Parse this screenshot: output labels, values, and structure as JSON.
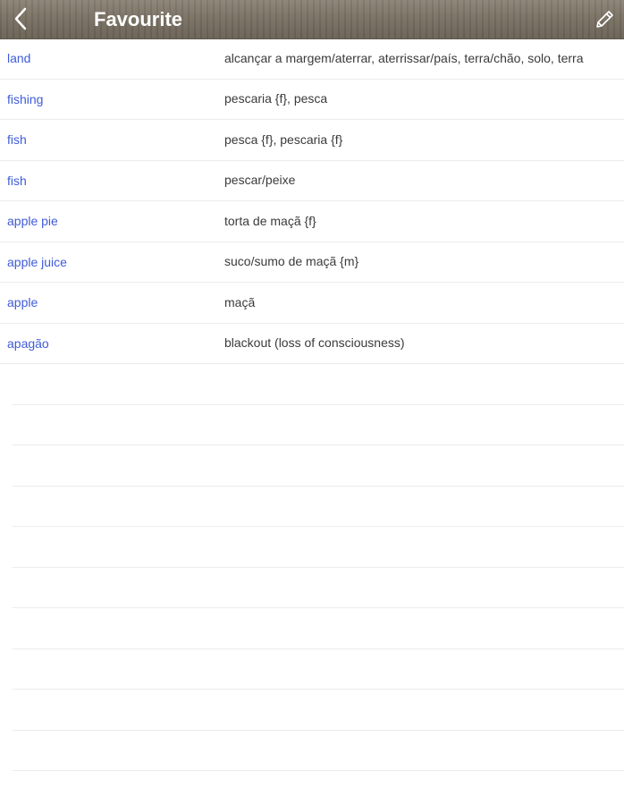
{
  "header": {
    "title": "Favourite",
    "back_icon": "chevron-left-icon",
    "edit_icon": "pencil-icon"
  },
  "entries": [
    {
      "word": "land",
      "translation": "alcançar a margem/aterrar, aterrissar/país, terra/chão, solo, terra"
    },
    {
      "word": "fishing",
      "translation": "pescaria {f}, pesca"
    },
    {
      "word": "fish",
      "translation": "pesca {f}, pescaria {f}"
    },
    {
      "word": "fish",
      "translation": "pescar/peixe"
    },
    {
      "word": "apple pie",
      "translation": "torta de maçã {f}"
    },
    {
      "word": "apple juice",
      "translation": "suco/sumo de maçã {m}"
    },
    {
      "word": "apple",
      "translation": "maçã"
    },
    {
      "word": "apagão",
      "translation": "blackout (loss of consciousness)"
    }
  ],
  "colors": {
    "word": "#3f5bd8",
    "translation": "#3a3a3a",
    "navbar": "#776e61"
  }
}
